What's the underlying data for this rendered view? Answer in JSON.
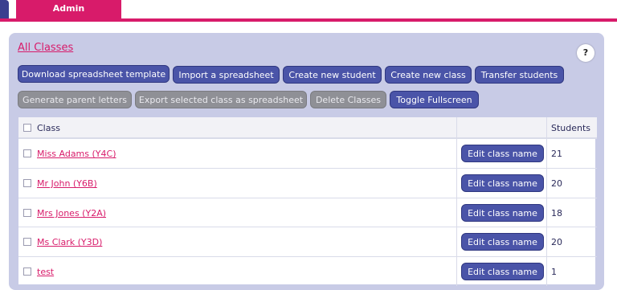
{
  "tabs": {
    "active": "Admin"
  },
  "page": {
    "title": "All Classes",
    "help": "?"
  },
  "toolbar": {
    "row1": [
      "Download spreadsheet template",
      "Import a spreadsheet",
      "Create new student",
      "Create new class",
      "Transfer students"
    ],
    "row2": [
      "Generate parent letters",
      "Export selected class as spreadsheet",
      "Delete Classes",
      "Toggle Fullscreen"
    ]
  },
  "table": {
    "headers": {
      "class": "Class",
      "actions": "",
      "students": "Students"
    },
    "rows": [
      {
        "class": "Miss Adams (Y4C)",
        "button": "Edit class name",
        "students": "21"
      },
      {
        "class": "Mr John (Y6B)",
        "button": "Edit class name",
        "students": "20"
      },
      {
        "class": "Mrs Jones (Y2A)",
        "button": "Edit class name",
        "students": "18"
      },
      {
        "class": "Ms Clark (Y3D)",
        "button": "Edit class name",
        "students": "20"
      },
      {
        "class": "test",
        "button": "Edit class name",
        "students": "1"
      }
    ]
  },
  "colors": {
    "brand": "#d81b6a",
    "primary": "#4a54a8",
    "panel": "#c8cbe6"
  }
}
